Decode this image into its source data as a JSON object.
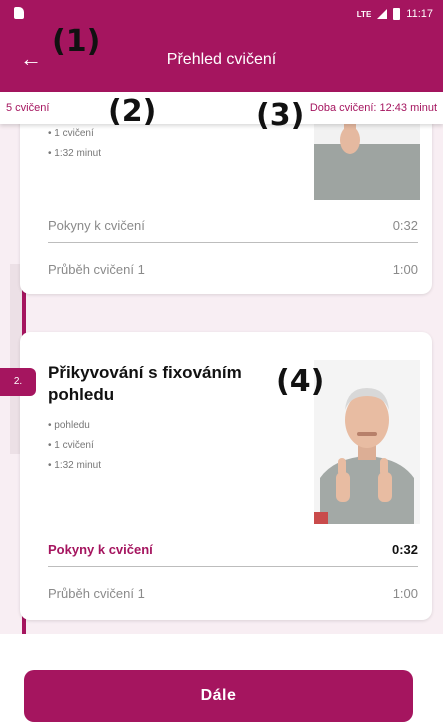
{
  "status_bar": {
    "network": "LTE",
    "time": "11:17"
  },
  "app_bar": {
    "back_icon": "arrow-left-icon",
    "title": "Přehled cvičení"
  },
  "summary": {
    "count": "5 cvičení",
    "duration": "Doba cvičení: 12:43 minut"
  },
  "callouts": [
    "(1)",
    "(2)",
    "(3)",
    "(4)"
  ],
  "exercises": [
    {
      "bullets": [
        "1 cvičení",
        "1:32 minut"
      ],
      "rows": [
        {
          "label": "Pokyny k cvičení",
          "value": "0:32"
        },
        {
          "label": "Průběh cvičení 1",
          "value": "1:00"
        }
      ]
    },
    {
      "step": "2.",
      "title": "Přikyvování s fixováním pohledu",
      "bullets": [
        "pohledu",
        "1 cvičení",
        "1:32 minut"
      ],
      "rows": [
        {
          "label": "Pokyny k cvičení",
          "value": "0:32",
          "active": true
        },
        {
          "label": "Průběh cvičení 1",
          "value": "1:00"
        }
      ]
    }
  ],
  "next_button": "Dále",
  "colors": {
    "primary": "#a5155f",
    "background": "#f8eef3"
  }
}
